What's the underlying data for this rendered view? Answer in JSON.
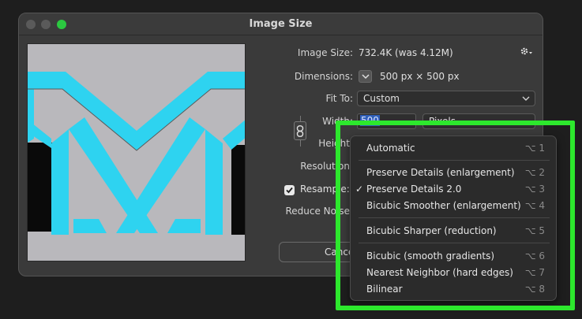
{
  "dialog": {
    "title": "Image Size"
  },
  "fields": {
    "image_size_label": "Image Size:",
    "image_size_value": "732.4K (was 4.12M)",
    "dimensions_label": "Dimensions:",
    "dimensions_value": "500 px  ×  500 px",
    "fit_to_label": "Fit To:",
    "fit_to_value": "Custom",
    "width_label": "Width:",
    "width_value": "500",
    "width_unit": "Pixels",
    "height_label": "Height:",
    "resolution_label": "Resolution:",
    "resample_label": "Resample:",
    "reduce_noise_label": "Reduce Noise:",
    "cancel_label": "Cancel"
  },
  "resample_menu": {
    "items": [
      {
        "label": "Automatic",
        "shortcut": "⌥ 1",
        "checked": false
      },
      {
        "label": "Preserve Details (enlargement)",
        "shortcut": "⌥ 2",
        "checked": false
      },
      {
        "label": "Preserve Details 2.0",
        "shortcut": "⌥ 3",
        "checked": true
      },
      {
        "label": "Bicubic Smoother (enlargement)",
        "shortcut": "⌥ 4",
        "checked": false
      },
      {
        "label": "Bicubic Sharper (reduction)",
        "shortcut": "⌥ 5",
        "checked": false
      },
      {
        "label": "Bicubic (smooth gradients)",
        "shortcut": "⌥ 6",
        "checked": false
      },
      {
        "label": "Nearest Neighbor (hard edges)",
        "shortcut": "⌥ 7",
        "checked": false
      },
      {
        "label": "Bilinear",
        "shortcut": "⌥ 8",
        "checked": false
      }
    ]
  },
  "icons": {
    "gear": "gear-icon",
    "link": "link-chain-icon",
    "checkmark": "checkmark-icon",
    "chevron": "chevron-down-icon"
  },
  "colors": {
    "accent_highlight": "#2de82d",
    "logo_cyan": "#2ed3f0",
    "preview_bg": "#b9b8bc",
    "selection_blue": "#2f5fb8"
  }
}
